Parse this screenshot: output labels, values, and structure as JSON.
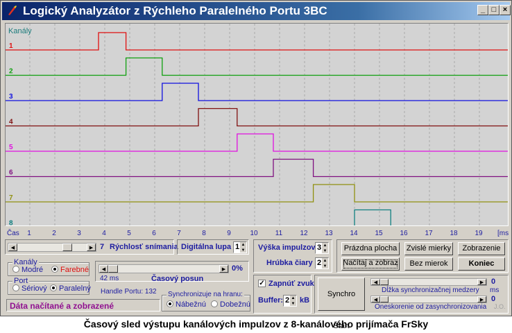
{
  "window": {
    "title": "Logický Analyzátor z Rýchleho Paralelného Portu 3BC",
    "controls": {
      "minimize": "_",
      "maximize": "□",
      "close": "×"
    }
  },
  "plot": {
    "channels_label": "Kanály",
    "channels": [
      {
        "label": "1",
        "color": "#e01010",
        "pulse_start": 3.75,
        "pulse_end": 4.85
      },
      {
        "label": "2",
        "color": "#10a010",
        "pulse_start": 4.85,
        "pulse_end": 6.3
      },
      {
        "label": "3",
        "color": "#1010e0",
        "pulse_start": 6.3,
        "pulse_end": 7.75
      },
      {
        "label": "4",
        "color": "#801010",
        "pulse_start": 7.75,
        "pulse_end": 9.3
      },
      {
        "label": "5",
        "color": "#e010e0",
        "pulse_start": 9.3,
        "pulse_end": 10.75
      },
      {
        "label": "6",
        "color": "#801080",
        "pulse_start": 10.75,
        "pulse_end": 12.35
      },
      {
        "label": "7",
        "color": "#909010",
        "pulse_start": 12.35,
        "pulse_end": 14.0
      },
      {
        "label": "8",
        "color": "#108080",
        "pulse_start": 14.0,
        "pulse_end": 15.45
      }
    ],
    "x_axis_label": "Čas",
    "x_unit": "[ms",
    "x_ticks": [
      "1",
      "2",
      "3",
      "4",
      "5",
      "6",
      "7",
      "8",
      "9",
      "10",
      "11",
      "12",
      "13",
      "14",
      "15",
      "16",
      "17",
      "18",
      "19"
    ]
  },
  "controls": {
    "speed_value": "7",
    "speed_label": "Rýchlosť snímania",
    "digital_zoom_label": "Digitálna lupa",
    "digital_zoom_value": "1",
    "pulse_height_label": "Výška impulzov",
    "pulse_height_value": "3",
    "line_thickness_label": "Hrúbka čiary",
    "line_thickness_value": "2",
    "btn_clear": "Prázdna plocha",
    "btn_vertical_scales": "Zvislé mierky",
    "btn_display": "Zobrazenie",
    "btn_load_display": "Načítaj a zobraz",
    "btn_no_scales": "Bez mierok",
    "btn_end": "Koniec",
    "channels_group": "Kanály",
    "channels_blue": "Modré",
    "channels_color": "Farebné",
    "port_group": "Port",
    "port_serial": "Sériový",
    "port_parallel": "Paralelný",
    "time_shift_percent": "0%",
    "time_shift_ms": "42 ms",
    "time_shift_label": "Časový posun",
    "handle_port": "Handle Portu: 132",
    "sync_group": "Synchronizuje na hranu:",
    "sync_rising": "Nábežnú",
    "sync_falling": "Dobežnú",
    "sound_on": "Zapnúť zvuk",
    "buffer_label": "Buffer:",
    "buffer_value": "2",
    "buffer_unit": "kB",
    "synchro_start": "Synchro Štart",
    "sync_gap_value": "0",
    "sync_gap_label": "Dĺžka synchronizačnej medzery",
    "sync_gap_unit": "ms",
    "delay_value": "0",
    "delay_label": "Oneskorenie od zasynchronizovania",
    "status": "Dáta načítané a zobrazené",
    "corner_mark": "J.O."
  },
  "caption": "Časový sled výstupu kanálových impulzov z 8-kanálového prijímača FrSky"
}
